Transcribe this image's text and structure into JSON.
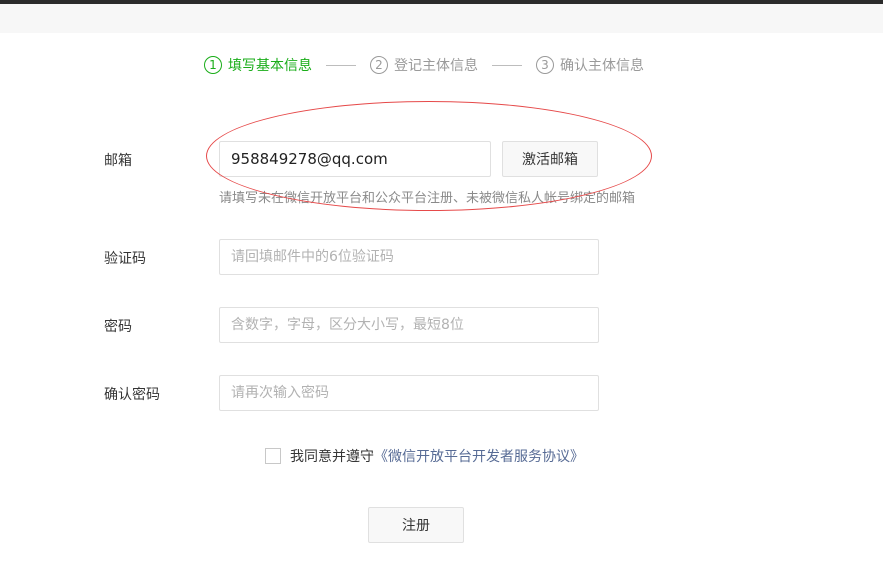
{
  "steps": [
    {
      "num": "1",
      "label": "填写基本信息"
    },
    {
      "num": "2",
      "label": "登记主体信息"
    },
    {
      "num": "3",
      "label": "确认主体信息"
    }
  ],
  "form": {
    "email": {
      "label": "邮箱",
      "value": "958849278@qq.com",
      "activate_button": "激活邮箱",
      "hint": "请填写未在微信开放平台和公众平台注册、未被微信私人帐号绑定的邮箱"
    },
    "code": {
      "label": "验证码",
      "placeholder": "请回填邮件中的6位验证码"
    },
    "password": {
      "label": "密码",
      "placeholder": "含数字，字母，区分大小写，最短8位"
    },
    "confirm": {
      "label": "确认密码",
      "placeholder": "请再次输入密码"
    },
    "agreement": {
      "prefix": "我同意并遵守",
      "link": "《微信开放平台开发者服务协议》"
    },
    "submit": "注册"
  },
  "colors": {
    "active_step": "#1aad19",
    "inactive_step": "#9a9a9a",
    "link": "#576b95",
    "annotation": "#e64a4a"
  }
}
